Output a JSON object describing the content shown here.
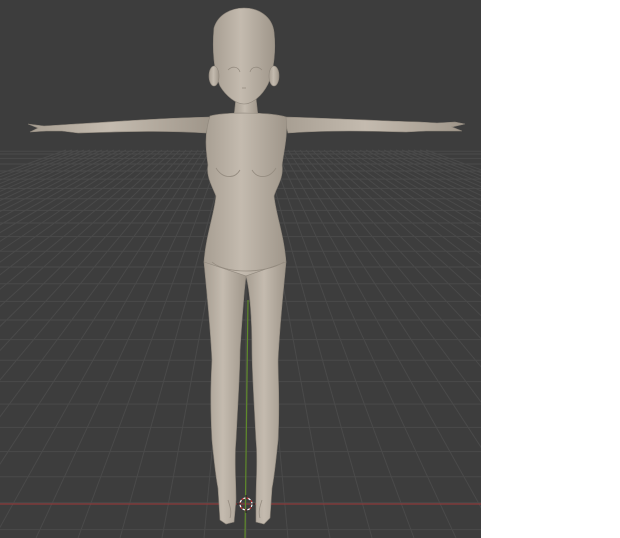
{
  "viewport": {
    "background": "#3d3d3d",
    "grid_line_color": "#4a4a4a",
    "x_axis_color": "#8b3a3a",
    "y_axis_color": "#5f8a2a"
  },
  "model": {
    "skin_color": "#bcb2a6",
    "shade_color": "#a0978b",
    "pose": "T-pose"
  },
  "icons": {
    "origin": "3d-cursor-icon"
  },
  "side_panel": {
    "background": "#ffffff"
  }
}
